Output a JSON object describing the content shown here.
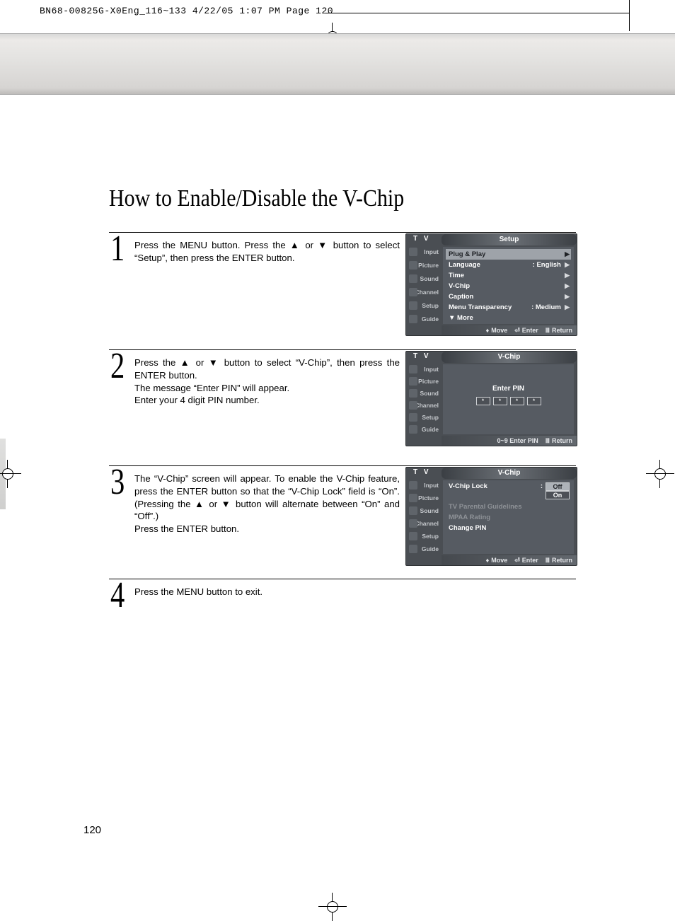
{
  "crop_header": "BN68-00825G-X0Eng_116~133  4/22/05  1:07 PM  Page 120",
  "page_title": "How to Enable/Disable the V-Chip",
  "page_number": "120",
  "steps": {
    "s1": {
      "num": "1",
      "text": "Press the MENU button. Press the ▲ or ▼ button to select “Setup”, then press the ENTER button."
    },
    "s2": {
      "num": "2",
      "text": "Press the ▲ or ▼ button to select “V-Chip”, then press the ENTER button.\nThe message “Enter PIN” will appear.\nEnter your 4 digit PIN number."
    },
    "s3": {
      "num": "3",
      "text": "The “V-Chip” screen will appear. To enable the V-Chip feature, press the ENTER button so that the “V-Chip Lock” field is “On”. (Pressing the ▲ or ▼ button will alternate between “On” and “Off”.)\nPress the ENTER button."
    },
    "s4": {
      "num": "4",
      "text": "Press the MENU button to exit."
    }
  },
  "osd_common": {
    "tv": "T V",
    "side": {
      "input": "Input",
      "picture": "Picture",
      "sound": "Sound",
      "channel": "Channel",
      "setup": "Setup",
      "guide": "Guide"
    },
    "help": {
      "move": "Move",
      "enter": "Enter",
      "return": "Return",
      "enterpin": "0~9 Enter PIN"
    }
  },
  "osd1": {
    "title": "Setup",
    "rows": {
      "r1": {
        "label": "Plug & Play",
        "val": ""
      },
      "r2": {
        "label": "Language",
        "val": ": English"
      },
      "r3": {
        "label": "Time",
        "val": ""
      },
      "r4": {
        "label": "V-Chip",
        "val": ""
      },
      "r5": {
        "label": "Caption",
        "val": ""
      },
      "r6": {
        "label": "Menu Transparency",
        "val": ": Medium"
      },
      "r7": {
        "label": "▼ More",
        "val": ""
      }
    }
  },
  "osd2": {
    "title": "V-Chip",
    "pinlabel": "Enter PIN",
    "pinchar": "*"
  },
  "osd3": {
    "title": "V-Chip",
    "rows": {
      "r1": {
        "label": "V-Chip Lock",
        "sep": ":"
      },
      "r2": {
        "label": "TV Parental Guidelines"
      },
      "r3": {
        "label": "MPAA Rating"
      },
      "r4": {
        "label": "Change PIN"
      }
    },
    "lock": {
      "off": "Off",
      "on": "On"
    }
  }
}
